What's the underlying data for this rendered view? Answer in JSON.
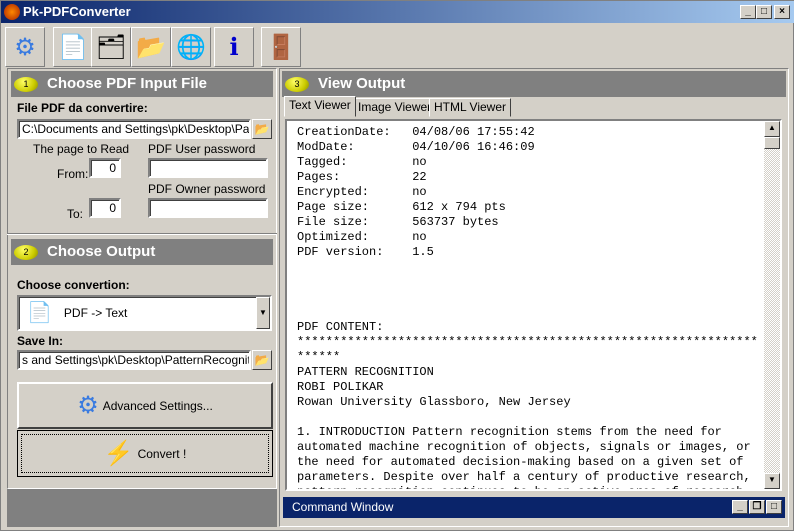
{
  "window": {
    "title": "Pk-PDFConverter",
    "min": "_",
    "max": "□",
    "close": "×"
  },
  "toolbar": [
    {
      "icon": "gear-icon",
      "glyph": "⚙"
    },
    {
      "icon": "text-document-icon",
      "glyph": "📄"
    },
    {
      "icon": "image-document-folder-icon",
      "glyph": "🗂"
    },
    {
      "icon": "images-to-folder-icon",
      "glyph": "📂"
    },
    {
      "icon": "html-document-folder-icon",
      "glyph": "🌐"
    },
    {
      "icon": "info-icon",
      "glyph": "ℹ"
    },
    {
      "icon": "exit-door-icon",
      "glyph": "🚪"
    }
  ],
  "input": {
    "number": "1",
    "header": "Choose PDF Input File",
    "file_label": "File PDF da convertire:",
    "file_value": "C:\\Documents and Settings\\pk\\Desktop\\PatternRecognition.pdf",
    "page_label": "The page to Read",
    "from_label": "From:",
    "from_value": "0",
    "to_label": "To:",
    "to_value": "0",
    "user_pw_label": "PDF User password",
    "user_pw_value": "",
    "owner_pw_label": "PDF Owner  password",
    "owner_pw_value": ""
  },
  "output": {
    "number": "2",
    "header": "Choose Output",
    "conv_label": "Choose convertion:",
    "conv_value": "PDF -> Text",
    "save_label": "Save In:",
    "save_value": "s and Settings\\pk\\Desktop\\PatternRecognition",
    "advanced": "Advanced Settings...",
    "convert": "Convert !"
  },
  "view": {
    "number": "3",
    "header": "View Output",
    "tabs": [
      "Text Viewer",
      "Image Viewer",
      "HTML Viewer"
    ],
    "active_tab": "Text Viewer",
    "text": "CreationDate:   04/08/06 17:55:42\nModDate:        04/10/06 16:46:09\nTagged:         no\nPages:          22\nEncrypted:      no\nPage size:      612 x 794 pts\nFile size:      563737 bytes\nOptimized:      no\nPDF version:    1.5\n\n\n\n\nPDF CONTENT:\n****************************************************************\n******\nPATTERN RECOGNITION\nROBI POLIKAR\nRowan University Glassboro, New Jersey\n\n1. INTRODUCTION Pattern recognition stems from the need for\nautomated machine recognition of objects, signals or images, or\nthe need for automated decision-making based on a given set of\nparameters. Despite over half a century of productive research,\npattern recognition continues to be an active area of research"
  },
  "command_window": {
    "title": "Command Window"
  }
}
